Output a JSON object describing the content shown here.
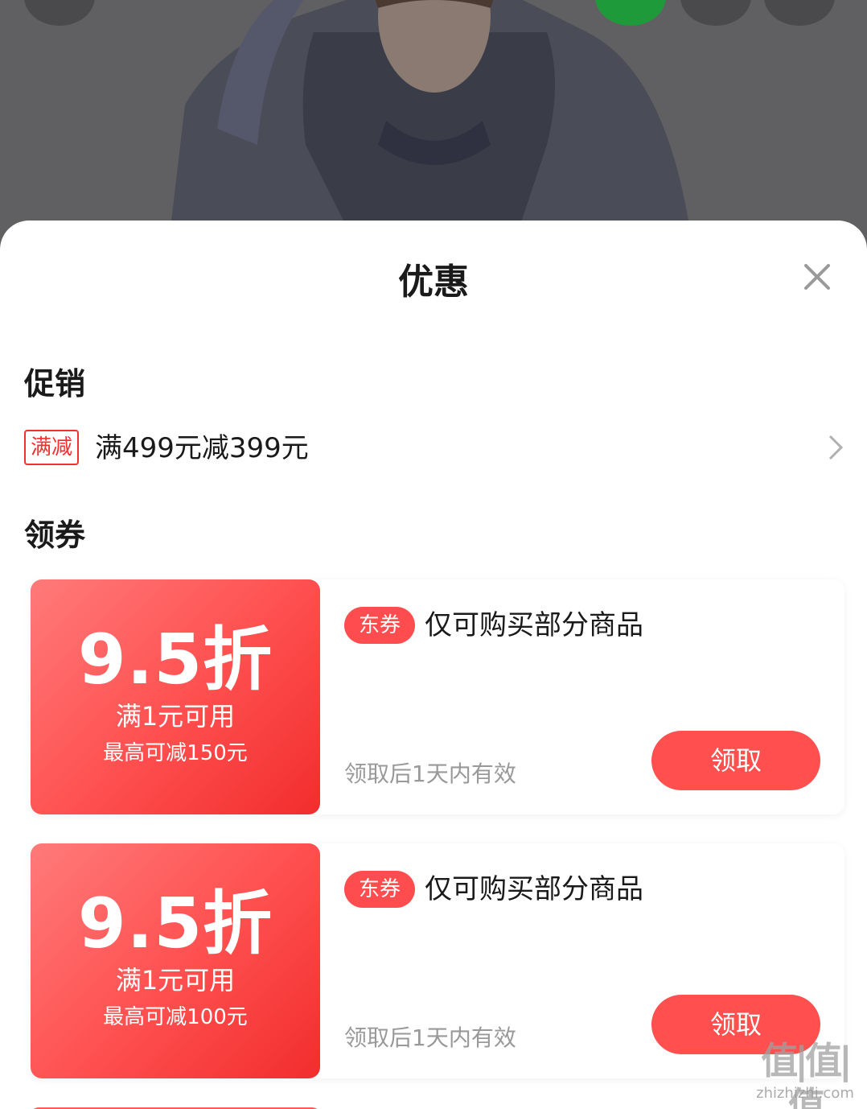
{
  "background": {
    "top_buttons": [
      "back-icon",
      "chat-icon",
      "cart-icon",
      "more-icon"
    ]
  },
  "sheet": {
    "title": "优惠",
    "close_icon": "close-icon"
  },
  "promotion": {
    "heading": "促销",
    "tag": "满减",
    "text": "满499元减399元",
    "arrow_icon": "chevron-right-icon"
  },
  "coupons": {
    "heading": "领券",
    "items": [
      {
        "discount": "9.5折",
        "threshold": "满1元可用",
        "max_off": "最高可减150元",
        "badge": "东券",
        "scope": "仅可购买部分商品",
        "validity": "领取后1天内有效",
        "claim_label": "领取"
      },
      {
        "discount": "9.5折",
        "threshold": "满1元可用",
        "max_off": "最高可减100元",
        "badge": "东券",
        "scope": "仅可购买部分商品",
        "validity": "领取后1天内有效",
        "claim_label": "领取"
      }
    ]
  },
  "watermark": {
    "big": "值|值|值",
    "small": "zhizhizhi.com"
  },
  "colors": {
    "accent": "#ff4f4f",
    "promo_tag": "#f23030",
    "muted_text": "#999999"
  }
}
